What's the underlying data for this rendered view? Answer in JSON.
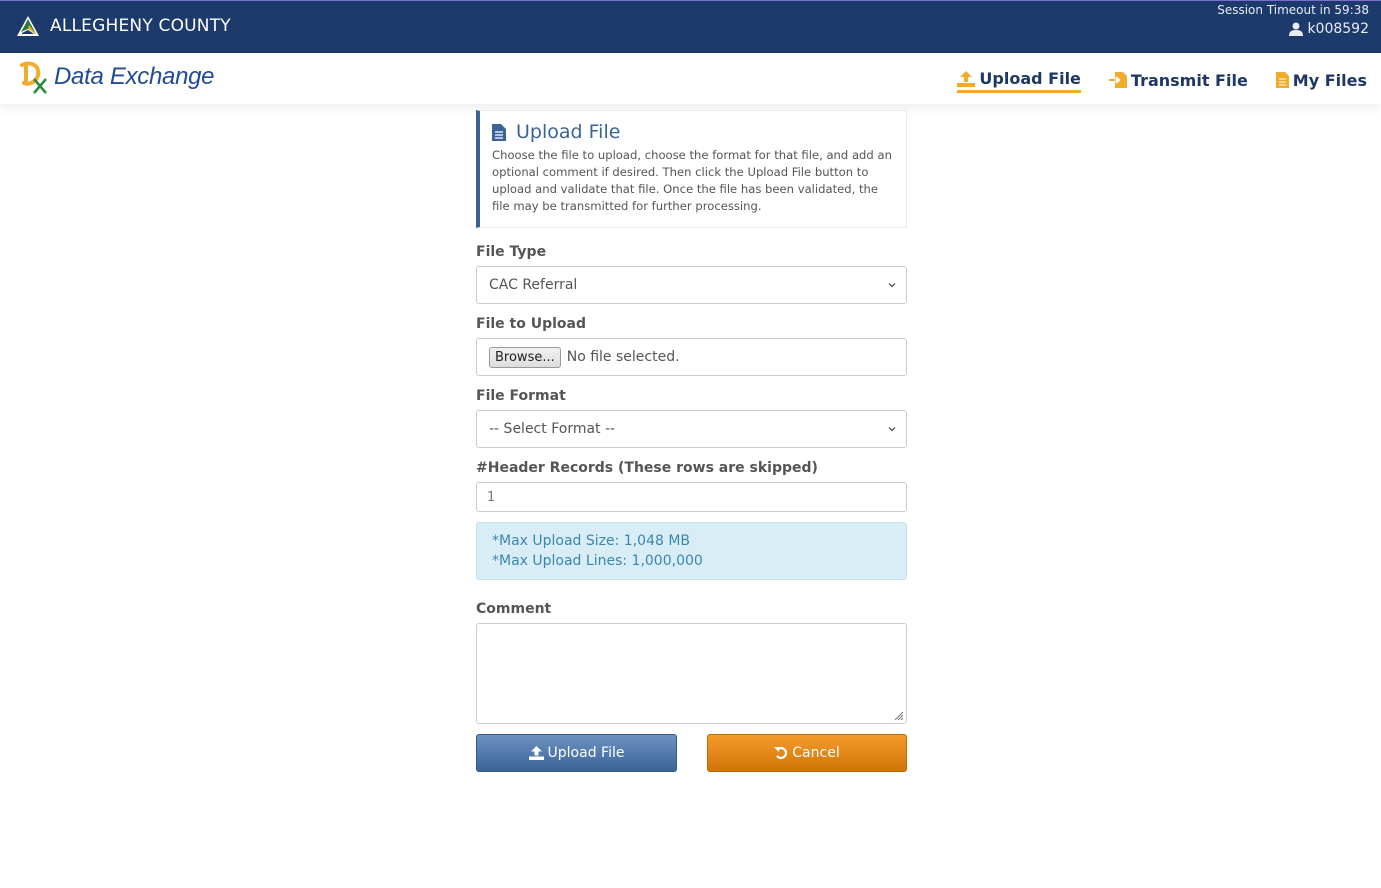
{
  "header": {
    "county_name": "ALLEGHENY COUNTY",
    "session_timeout": "Session Timeout in 59:38",
    "username": "k008592",
    "user_icon": "user-icon",
    "county_logo_icon": "mountain-logo-icon"
  },
  "navbar": {
    "brand": "Data Exchange",
    "brand_logo_icon": "dx-logo-icon",
    "items": [
      {
        "label": "Upload File",
        "icon": "upload-icon",
        "active": true
      },
      {
        "label": "Transmit File",
        "icon": "file-import-icon",
        "active": false
      },
      {
        "label": "My Files",
        "icon": "file-icon",
        "active": false
      }
    ],
    "accent_color": "#f2ac2c"
  },
  "info": {
    "title": "Upload File",
    "icon": "file-text-icon",
    "description": "Choose the file to upload, choose the format for that file, and add an optional comment if desired. Then click the Upload File button to upload and validate that file. Once the file has been validated, the file may be transmitted for further processing."
  },
  "form": {
    "file_type": {
      "label": "File Type",
      "value": "CAC Referral"
    },
    "file_upload": {
      "label": "File to Upload",
      "button": "Browse...",
      "status": "No file selected."
    },
    "file_format": {
      "label": "File Format",
      "value": "-- Select Format --"
    },
    "header_records": {
      "label": "#Header Records (These rows are skipped)",
      "value": "1"
    },
    "limits": {
      "max_size": "*Max Upload Size: 1,048 MB",
      "max_lines": "*Max Upload Lines: 1,000,000"
    },
    "comment": {
      "label": "Comment",
      "value": ""
    },
    "upload_button": "Upload File",
    "cancel_button": "Cancel"
  },
  "colors": {
    "topbar": "#1c3a6b",
    "primary": "#3b6497",
    "warning": "#d17407",
    "info_bg": "#d9edf7"
  }
}
